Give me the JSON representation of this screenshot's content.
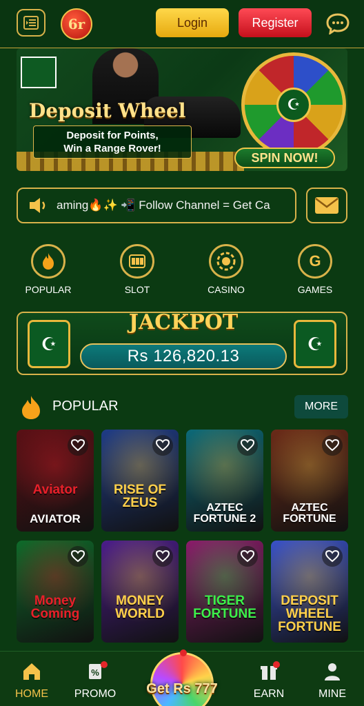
{
  "header": {
    "login_label": "Login",
    "register_label": "Register",
    "logo_text": "6r"
  },
  "banner": {
    "title": "Deposit Wheel",
    "subtitle_line1": "Deposit for Points,",
    "subtitle_line2": "Win a Range Rover!",
    "spin_label": "SPIN NOW!"
  },
  "marquee": {
    "text": "aming🔥✨    📲 Follow Channel = Get Ca"
  },
  "categories": [
    {
      "label": "POPULAR",
      "icon": "flame-icon"
    },
    {
      "label": "SLOT",
      "icon": "slot-machine-icon"
    },
    {
      "label": "CASINO",
      "icon": "casino-chip-icon"
    },
    {
      "label": "GAMES",
      "icon": "g-icon"
    }
  ],
  "jackpot": {
    "title": "JACKPOT",
    "amount": "Rs 126,820.13"
  },
  "popular": {
    "title": "POPULAR",
    "more_label": "MORE"
  },
  "games": [
    {
      "title": "AVIATOR",
      "art_text": "Aviator",
      "bg": "#5a1015",
      "accent": "#e8202a"
    },
    {
      "title": "",
      "art_text": "RISE OF ZEUS",
      "bg": "#1f3c86",
      "accent": "#ffd04a"
    },
    {
      "title": "AZTEC FORTUNE 2",
      "art_text": "",
      "bg": "#0d6a78",
      "accent": "#f0c24a"
    },
    {
      "title": "AZTEC FORTUNE",
      "art_text": "",
      "bg": "#6a2a18",
      "accent": "#f0c24a"
    },
    {
      "title": "",
      "art_text": "Money Coming",
      "bg": "#0f6a2a",
      "accent": "#e8202a"
    },
    {
      "title": "",
      "art_text": "MONEY WORLD",
      "bg": "#4b1d8a",
      "accent": "#ffd04a"
    },
    {
      "title": "",
      "art_text": "TIGER FORTUNE",
      "bg": "#8a1d6a",
      "accent": "#3cf04a"
    },
    {
      "title": "",
      "art_text": "DEPOSIT WHEEL FORTUNE",
      "bg": "#3a52c8",
      "accent": "#ffd04a"
    }
  ],
  "bottom_nav": {
    "home_label": "HOME",
    "promo_label": "PROMO",
    "bonus_label": "Get Rs 777",
    "earn_label": "EARN",
    "mine_label": "MINE"
  }
}
